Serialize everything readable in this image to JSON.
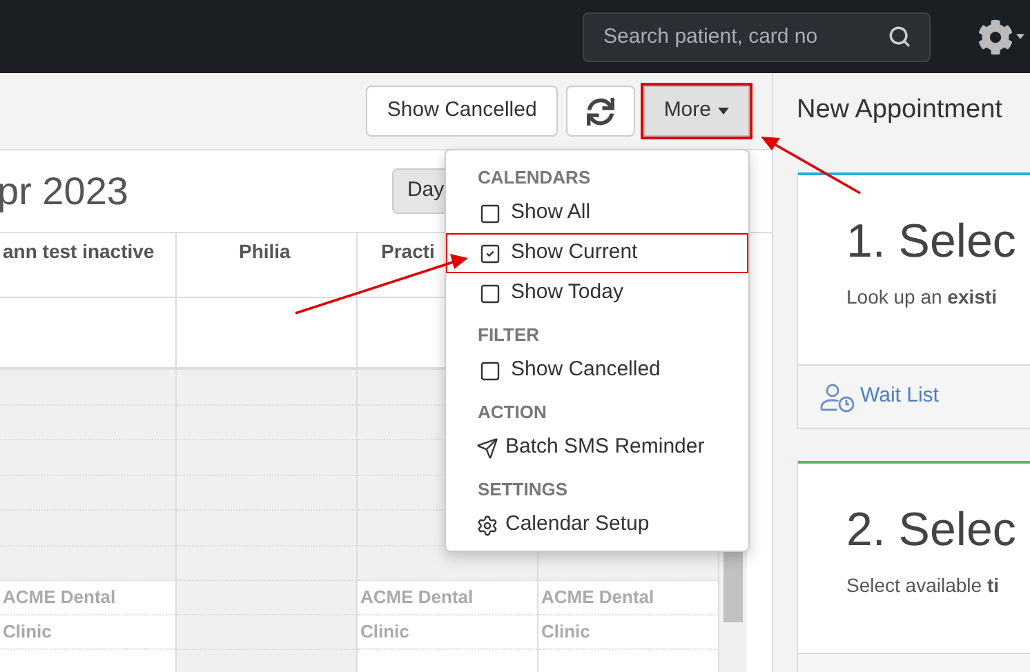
{
  "navbar": {
    "search": {
      "placeholder": "Search patient, card no"
    }
  },
  "toolbar": {
    "buttons": [
      {
        "kind": "text",
        "label": "Show Cancelled"
      },
      {
        "kind": "refresh"
      },
      {
        "kind": "menu",
        "label": "More",
        "annotated": true
      }
    ]
  },
  "calendar": {
    "title": "pr 2023",
    "view_button": "Day",
    "columns": [
      {
        "header": "ann test inactive",
        "available": true,
        "clinic_lines": [
          "ACME Dental",
          "Clinic"
        ]
      },
      {
        "header": "Philia",
        "available": false
      },
      {
        "header": "Practi",
        "available": true,
        "clinic_lines": [
          "ACME Dental",
          "Clinic"
        ]
      },
      {
        "available": true,
        "clinic_lines": [
          "ACME Dental",
          "Clinic"
        ]
      }
    ]
  },
  "more_menu": {
    "items": [
      {
        "kind": "header",
        "label": "CALENDARS"
      },
      {
        "kind": "checkbox",
        "label": "Show All",
        "checked": false,
        "annotated": false
      },
      {
        "kind": "checkbox",
        "label": "Show Current",
        "checked": true,
        "annotated": true
      },
      {
        "kind": "checkbox",
        "label": "Show Today",
        "checked": false,
        "annotated": false
      },
      {
        "kind": "header",
        "label": "FILTER"
      },
      {
        "kind": "checkbox",
        "label": "Show Cancelled",
        "checked": false,
        "annotated": false
      },
      {
        "kind": "header",
        "label": "ACTION"
      },
      {
        "kind": "sms",
        "label": "Batch SMS Reminder"
      },
      {
        "kind": "header",
        "label": "SETTINGS"
      },
      {
        "kind": "setup",
        "label": "Calendar Setup"
      }
    ]
  },
  "new_appointment": {
    "title": "New Appointment",
    "steps": [
      {
        "title": "1. Selec",
        "text": "Look up an **existi**",
        "color": "#29a9e0",
        "footer_link": "Wait List"
      },
      {
        "title": "2. Selec",
        "text": "Select available **ti**",
        "color": "#5cb85c"
      }
    ]
  }
}
